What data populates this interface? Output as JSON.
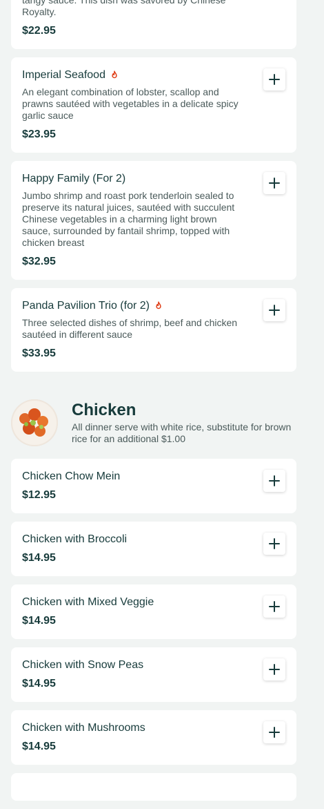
{
  "items_top": [
    {
      "name": "",
      "desc": "tangy sauce. This dish was savored by Chinese Royalty.",
      "price": "$22.95",
      "spicy": false
    },
    {
      "name": "Imperial Seafood",
      "desc": "An elegant combination of lobster, scallop and prawns sautéed with vegetables in a delicate spicy garlic sauce",
      "price": "$23.95",
      "spicy": true
    },
    {
      "name": "Happy Family (For 2)",
      "desc": "Jumbo shrimp and roast pork tenderloin sealed to preserve its natural juices, sautéed with succulent Chinese vegetables in a charming light brown sauce, surrounded by fantail shrimp, topped with chicken breast",
      "price": "$32.95",
      "spicy": false
    },
    {
      "name": "Panda Pavilion Trio (for 2)",
      "desc": "Three selected dishes of shrimp, beef and chicken sautéed in different sauce",
      "price": "$33.95",
      "spicy": true
    }
  ],
  "section": {
    "title": "Chicken",
    "subtitle": "All dinner serve with white rice, substitute for brown rice for an additional $1.00"
  },
  "chicken_items": [
    {
      "name": "Chicken Chow Mein",
      "price": "$12.95"
    },
    {
      "name": "Chicken with Broccoli",
      "price": "$14.95"
    },
    {
      "name": "Chicken with Mixed Veggie",
      "price": "$14.95"
    },
    {
      "name": "Chicken with Snow Peas",
      "price": "$14.95"
    },
    {
      "name": "Chicken with Mushrooms",
      "price": "$14.95"
    }
  ],
  "icons": {
    "add": "plus-icon",
    "spicy": "fire-icon"
  },
  "colors": {
    "heading": "#173b3b",
    "fire": "#e0401a",
    "bg": "#f1f4f3"
  }
}
